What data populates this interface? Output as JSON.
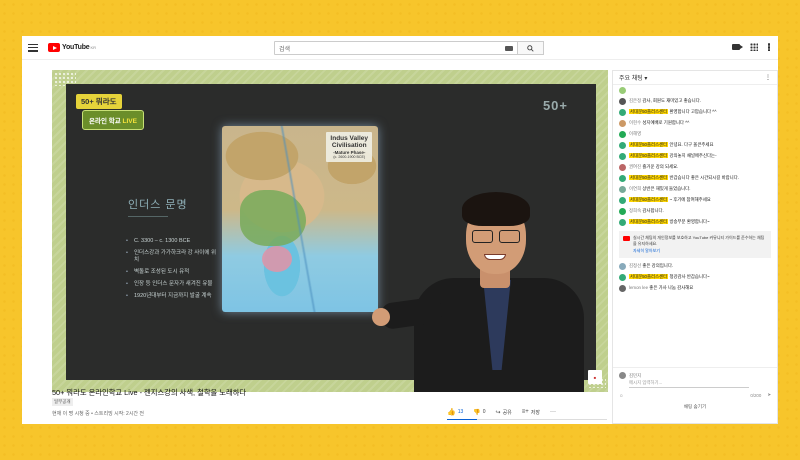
{
  "topbar": {
    "logo_text": "YouTube",
    "logo_region": "KR",
    "search_placeholder": "검색"
  },
  "video": {
    "logo_top": "50+ 뭐라도",
    "logo_bottom_prefix": "온라인 학교",
    "logo_bottom_live": "LIVE",
    "brand_right": "50+",
    "slide_title": "인더스 문명",
    "slide_bullets": [
      "C. 3300 – c. 1300 BCE",
      "인더스강과 가가하크라 강 사이에 위치",
      "벽돌로 조성된 도시 유적",
      "인장 등 인더스 문자가 새겨진 유물",
      "1920년대부터 지금까지 발굴 계속"
    ],
    "map_title_1": "Indus Valley",
    "map_title_2": "Civilisation",
    "map_title_3": "-Mature Phase-",
    "map_title_4": "(c. 2600-1900 BCE)",
    "title": "50+ 뭐라도 온라인학교 Live - 젠지스강의 사색, 철학을 노래하다",
    "visibility": "일부공개",
    "meta": "현재 이 명 시청 중 • 스트리밍 시작: 2시간 전",
    "likes": "13",
    "dislikes": "0",
    "share_label": "공유",
    "save_label": "저장"
  },
  "chat": {
    "header": "주요 채팅",
    "messages": [
      {
        "author": "",
        "text": "",
        "highlight": false,
        "avatar_color": "#9c7"
      },
      {
        "author": "김은정",
        "text": "감사, 회원도 재미있고 좋습니다.",
        "highlight": false,
        "avatar_color": "#555"
      },
      {
        "author": "서대문50플러스센터",
        "text": "환영합니다 고맙습니다 ^^",
        "highlight": true,
        "avatar_color": "#3a7"
      },
      {
        "author": "이현수",
        "text": "성지예배로 기원합니다 ^^",
        "highlight": false,
        "avatar_color": "#c96"
      },
      {
        "author": "이해영",
        "text": "",
        "highlight": false,
        "avatar_color": "#2a5"
      },
      {
        "author": "서대문50플러스센터",
        "text": "안녕요. 다구 올큰주세요",
        "highlight": true,
        "avatar_color": "#3a7"
      },
      {
        "author": "서대문50플러스센터",
        "text": "강의놓지 채널에주신다는-",
        "highlight": true,
        "avatar_color": "#3a7"
      },
      {
        "author": "권여진",
        "text": "즐거운 강의 되세요.",
        "highlight": false,
        "avatar_color": "#b66"
      },
      {
        "author": "서대문50플러스센터",
        "text": "반갑습니다 좋은 시간되시길 바랍니다.",
        "highlight": true,
        "avatar_color": "#3a7"
      },
      {
        "author": "이연희",
        "text": "상반은 재밌게 들었습니다.",
        "highlight": false,
        "avatar_color": "#7a9"
      },
      {
        "author": "서대문50플러스센터",
        "text": "~ 후기에 참여해주세요",
        "highlight": true,
        "avatar_color": "#3a7"
      },
      {
        "author": "정희숙",
        "text": "감사합니다.",
        "highlight": false,
        "avatar_color": "#2a5"
      },
      {
        "author": "서대문50플러스센터",
        "text": "방송부분 환영합니다~",
        "highlight": true,
        "avatar_color": "#3a7"
      },
      {
        "author": "김정선",
        "text": "좋은 강의입니다.",
        "highlight": false,
        "avatar_color": "#8ab"
      },
      {
        "author": "서대문50플러스센터",
        "text": "청강감사 반갑습니다~",
        "highlight": true,
        "avatar_color": "#3a7"
      },
      {
        "author": "lemon lee",
        "text": "좋은 가사 나눔 감사해요",
        "highlight": false,
        "avatar_color": "#666"
      }
    ],
    "notice_text": "실시간 채팅의 개인정보를 보호하고 YouTube 커뮤니티 가이드를 준수하는 채팅을 유지하세요.",
    "notice_link": "자세히 알아보기",
    "input_user": "김민지",
    "input_placeholder": "메시지 입력하기...",
    "char_count": "0/200",
    "hide_label": "채팅 숨기기"
  }
}
